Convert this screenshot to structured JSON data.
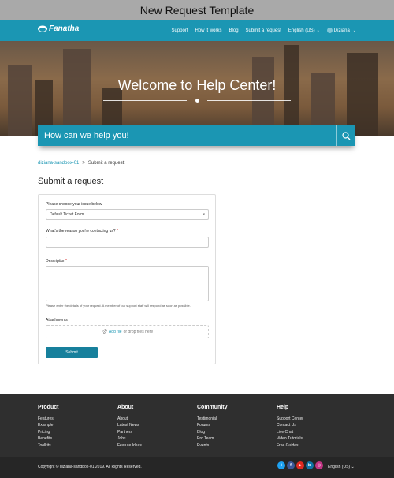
{
  "window_title": "New Request Template",
  "brand": {
    "name": "Fanatha"
  },
  "nav": {
    "links": [
      "Support",
      "How it works",
      "Blog",
      "Submit a request"
    ],
    "language": "English (US)",
    "user": "Diziana"
  },
  "hero": {
    "title": "Welcome to Help Center!"
  },
  "search": {
    "placeholder": "How can we help you!"
  },
  "breadcrumb": [
    "diziana-sandbox-01",
    ">",
    "Submit a request"
  ],
  "page_title": "Submit a request",
  "form": {
    "issue_label": "Please choose your issue below",
    "issue_value": "Default Ticket Form",
    "reason_label": "What's the reason you're contacting us?",
    "required_mark": "*",
    "description_label": "Description",
    "description_hint": "Please enter the details of your request. A member of our support staff will respond as soon as possible.",
    "attachments_label": "Attachments",
    "attach_add": "Add file",
    "attach_rest": "or drop files here",
    "submit_label": "Submit"
  },
  "footer": {
    "columns": [
      {
        "title": "Product",
        "items": [
          "Features",
          "Example",
          "Pricing",
          "Benefits",
          "Toolkits"
        ]
      },
      {
        "title": "About",
        "items": [
          "About",
          "Latest News",
          "Partners",
          "Jobs",
          "Feature Ideas"
        ]
      },
      {
        "title": "Community",
        "items": [
          "Testimonial",
          "Forums",
          "Blog",
          "Pro Team",
          "Events"
        ]
      },
      {
        "title": "Help",
        "items": [
          "Support Center",
          "Contact Us",
          "Live Chat",
          "Video Tutorials",
          "Free Guides"
        ]
      }
    ],
    "copyright": "Copyright © diziana-sandbox-01 2019. All Rights Reserved.",
    "language": "English (US)",
    "social_icons": [
      "twitter-icon",
      "facebook-icon",
      "youtube-icon",
      "linkedin-icon",
      "instagram-icon"
    ]
  },
  "colors": {
    "accent": "#1b96b3",
    "footer_bg": "#2f2f2f"
  }
}
